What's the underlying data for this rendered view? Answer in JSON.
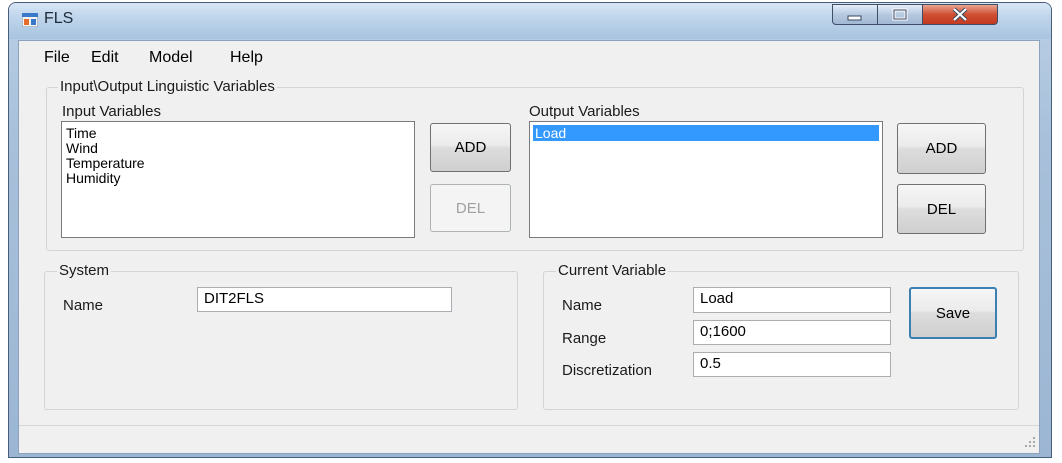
{
  "window": {
    "title": "FLS",
    "icon": "app-window-icon"
  },
  "menu": [
    "File",
    "Edit",
    "Model",
    "Help"
  ],
  "io_group": {
    "label": "Input\\Output Linguistic Variables",
    "input": {
      "label": "Input Variables",
      "items": [
        "Time",
        "Wind",
        "Temperature",
        "Humidity"
      ],
      "add_label": "ADD",
      "del_label": "DEL"
    },
    "output": {
      "label": "Output Variables",
      "items": [
        "Load"
      ],
      "selected": "Load",
      "add_label": "ADD",
      "del_label": "DEL"
    }
  },
  "system": {
    "label": "System",
    "name_label": "Name",
    "name_value": "DIT2FLS"
  },
  "current_variable": {
    "label": "Current Variable",
    "name_label": "Name",
    "name_value": "Load",
    "range_label": "Range",
    "range_value": "0;1600",
    "discretization_label": "Discretization",
    "discretization_value": "0.5",
    "save_label": "Save"
  },
  "colors": {
    "selection": "#3399ff",
    "close_button": "#c9442a"
  }
}
